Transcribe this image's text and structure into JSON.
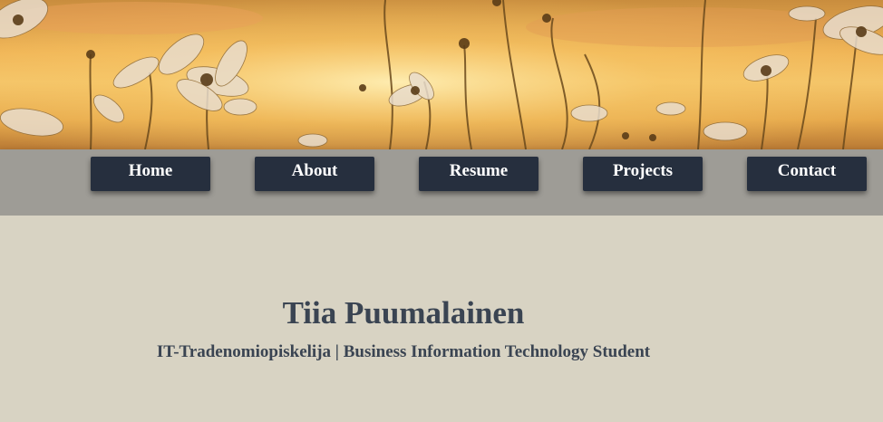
{
  "nav": {
    "items": [
      {
        "label": "Home"
      },
      {
        "label": "About"
      },
      {
        "label": "Resume"
      },
      {
        "label": "Projects"
      },
      {
        "label": "Contact"
      }
    ]
  },
  "profile": {
    "name": "Tiia Puumalainen",
    "subtitle": "IT-Tradenomiopiskelija | Business Information Technology Student"
  },
  "colors": {
    "nav_button_bg": "#262f3e",
    "nav_bar_bg": "#9e9c96",
    "page_bg": "#d8d3c3",
    "heading_text": "#3a4452"
  }
}
